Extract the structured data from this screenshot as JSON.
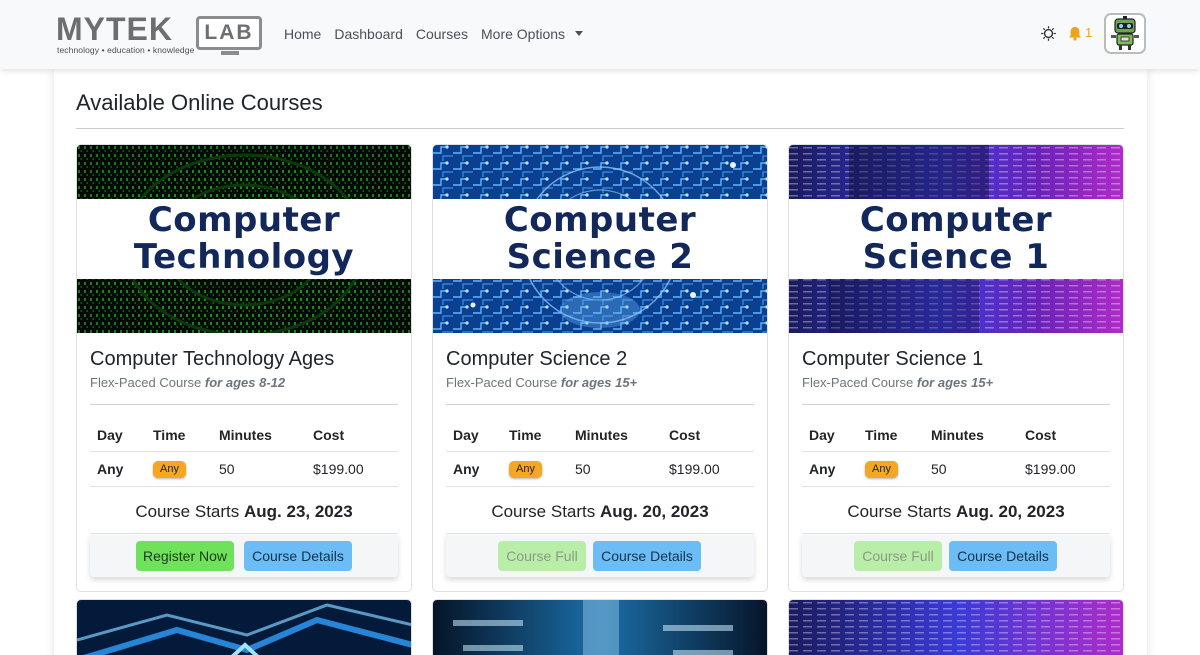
{
  "brand": {
    "word_a": "MYTE",
    "word_b": "K",
    "box": "LAB",
    "tagline": "technology • education • knowledge"
  },
  "nav": {
    "items": [
      "Home",
      "Dashboard",
      "Courses"
    ],
    "more": "More Options",
    "notif_count": "1"
  },
  "page": {
    "title": "Available Online Courses"
  },
  "table_headers": {
    "day": "Day",
    "time": "Time",
    "minutes": "Minutes",
    "cost": "Cost"
  },
  "courses": [
    {
      "banner_line1": "Computer",
      "banner_line2": "Technology",
      "title": "Computer Technology Ages",
      "sub_prefix": "Flex-Paced Course",
      "sub_ages": "for ages 8-12",
      "day": "Any",
      "time": "Any",
      "minutes": "50",
      "cost": "$199.00",
      "starts_prefix": "Course Starts",
      "starts_date": "Aug. 23, 2023",
      "primary_btn": "Register Now",
      "details_btn": "Course Details"
    },
    {
      "banner_line1": "Computer",
      "banner_line2": "Science 2",
      "title": "Computer Science 2",
      "sub_prefix": "Flex-Paced Course",
      "sub_ages": "for ages 15+",
      "day": "Any",
      "time": "Any",
      "minutes": "50",
      "cost": "$199.00",
      "starts_prefix": "Course Starts",
      "starts_date": "Aug. 20, 2023",
      "primary_btn": "Course Full",
      "details_btn": "Course Details"
    },
    {
      "banner_line1": "Computer",
      "banner_line2": "Science 1",
      "title": "Computer Science 1",
      "sub_prefix": "Flex-Paced Course",
      "sub_ages": "for ages 15+",
      "day": "Any",
      "time": "Any",
      "minutes": "50",
      "cost": "$199.00",
      "starts_prefix": "Course Starts",
      "starts_date": "Aug. 20, 2023",
      "primary_btn": "Course Full",
      "details_btn": "Course Details"
    }
  ],
  "colors": {
    "brand_gray": "#6d6e71",
    "banner_text": "#13285a",
    "register": "#6fe15b",
    "full": "#b9eea8",
    "details": "#6cbcf5",
    "badge": "#f5a623",
    "bell": "#f0a020"
  },
  "icons": [
    "theme-sun-icon",
    "bell-icon",
    "robot-avatar-icon",
    "caret-down-icon"
  ]
}
